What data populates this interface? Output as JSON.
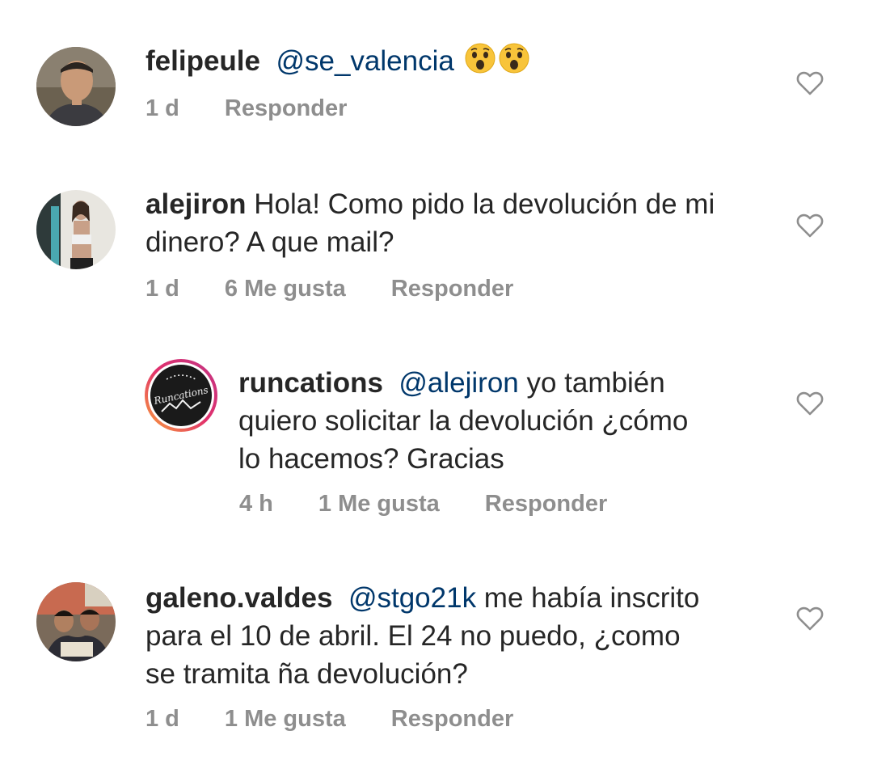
{
  "comments": [
    {
      "username": "felipeule",
      "mention": "@se_valencia",
      "text_after": "",
      "emojis": [
        "astonished-face-icon",
        "astonished-face-icon"
      ],
      "time": "1 d",
      "likes": "",
      "reply_label": "Responder"
    },
    {
      "username": "alejiron",
      "mention": "",
      "text_line1": " Hola! Como pido la devolución de mi",
      "text_line2": "dinero? A que mail?",
      "time": "1 d",
      "likes": "6 Me gusta",
      "reply_label": "Responder"
    },
    {
      "username": "runcations",
      "mention": "@alejiron",
      "text_line1": " yo también",
      "text_line2": "quiero solicitar la devolución ¿cómo",
      "text_line3": "lo hacemos? Gracias",
      "time": "4 h",
      "likes": "1 Me gusta",
      "reply_label": "Responder",
      "avatar_text": "Runcations"
    },
    {
      "username": "galeno.valdes",
      "mention": "@stgo21k",
      "text_line1": " me había inscrito",
      "text_line2": "para el 10 de abril. El 24 no puedo, ¿como",
      "text_line3": "se tramita ña devolución?",
      "time": "1 d",
      "likes": "1 Me gusta",
      "reply_label": "Responder"
    }
  ],
  "colors": {
    "text": "#262626",
    "mention": "#00376b",
    "meta": "#8e8e8e",
    "heart_stroke": "#8e8e8e"
  }
}
